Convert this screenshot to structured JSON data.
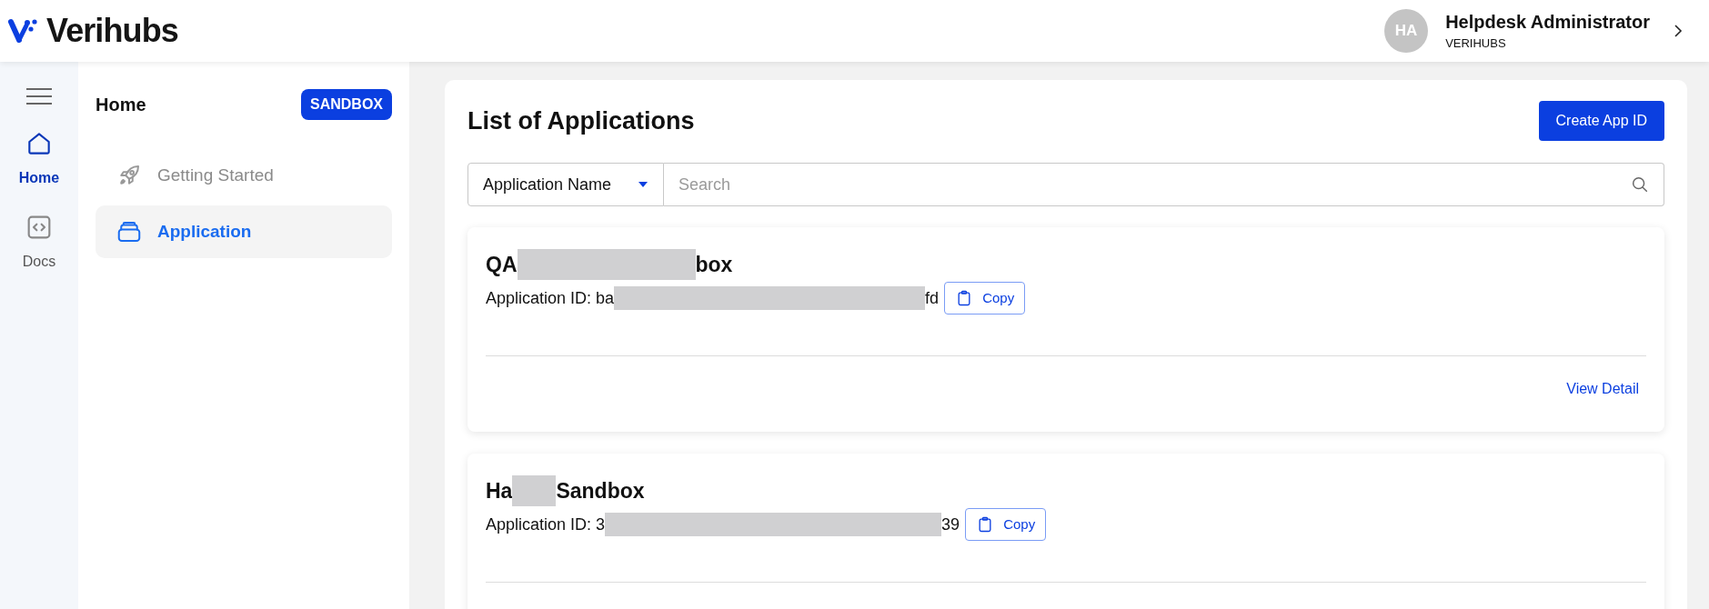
{
  "header": {
    "logo": "Verihubs",
    "user": {
      "initials": "HA",
      "name": "Helpdesk Administrator",
      "org": "VERIHUBS"
    }
  },
  "rail": [
    {
      "label": "Home",
      "selected": true
    },
    {
      "label": "Docs",
      "selected": false
    }
  ],
  "sidebar": {
    "title": "Home",
    "badge": "SANDBOX",
    "items": [
      {
        "label": "Getting Started",
        "selected": false
      },
      {
        "label": "Application",
        "selected": true
      }
    ]
  },
  "main": {
    "title": "List of Applications",
    "create_button": "Create App ID",
    "filter": {
      "value": "Application Name"
    },
    "search": {
      "placeholder": "Search"
    },
    "applications": [
      {
        "name_start": "QA",
        "name_end": "box",
        "id_label": "Application ID:",
        "id_start": "ba",
        "id_end": "fd",
        "copy": "Copy",
        "view": "View Detail"
      },
      {
        "name_start": "Ha",
        "name_end": "Sandbox",
        "id_label": "Application ID:",
        "id_start": "3",
        "id_end": "39",
        "copy": "Copy"
      }
    ]
  }
}
